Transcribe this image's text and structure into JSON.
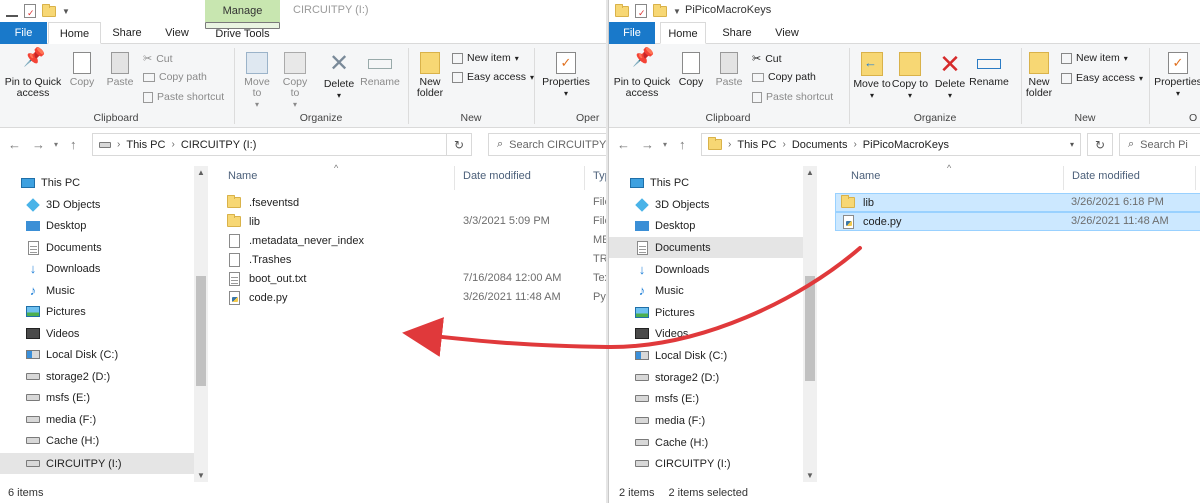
{
  "colors": {
    "file_tab": "#1979ca",
    "manage_tab": "#c8e6b0",
    "selection": "#cce8ff",
    "arrow": "#e0393b"
  },
  "left": {
    "quick_access": [
      "save-icon",
      "properties-icon",
      "new-folder-icon",
      "dropdown-arrow"
    ],
    "manage_label": "Manage",
    "title": "CIRCUITPY (I:)",
    "tabs": {
      "file": "File",
      "home": "Home",
      "share": "Share",
      "view": "View",
      "drive_tools": "Drive Tools"
    },
    "ribbon": {
      "pin": "Pin to Quick access",
      "copy": "Copy",
      "paste": "Paste",
      "cut": "Cut",
      "copy_path": "Copy path",
      "paste_shortcut": "Paste shortcut",
      "move_to": "Move to",
      "copy_to": "Copy to",
      "delete": "Delete",
      "rename": "Rename",
      "new_folder": "New folder",
      "new_item": "New item",
      "easy_access": "Easy access",
      "properties": "Properties",
      "groups": {
        "clipboard": "Clipboard",
        "organize": "Organize",
        "new": "New",
        "open": "Oper"
      }
    },
    "address": {
      "this_pc": "This PC",
      "location": "CIRCUITPY (I:)"
    },
    "search_placeholder": "Search CIRCUITPY",
    "nav": {
      "this_pc": "This PC",
      "objects": "3D Objects",
      "desktop": "Desktop",
      "documents": "Documents",
      "downloads": "Downloads",
      "music": "Music",
      "pictures": "Pictures",
      "videos": "Videos",
      "local_c": "Local Disk (C:)",
      "storage_d": "storage2 (D:)",
      "msfs_e": "msfs (E:)",
      "media_f": "media (F:)",
      "cache_h": "Cache (H:)",
      "circuitpy_i": "CIRCUITPY (I:)"
    },
    "columns": {
      "name": "Name",
      "date": "Date modified",
      "type": "Typ"
    },
    "files": [
      {
        "name": ".fseventsd",
        "date": "",
        "type": "File"
      },
      {
        "name": "lib",
        "date": "3/3/2021 5:09 PM",
        "type": "File"
      },
      {
        "name": ".metadata_never_index",
        "date": "",
        "type": "ME"
      },
      {
        "name": ".Trashes",
        "date": "",
        "type": "TR"
      },
      {
        "name": "boot_out.txt",
        "date": "7/16/2084 12:00 AM",
        "type": "Tex"
      },
      {
        "name": "code.py",
        "date": "3/26/2021 11:48 AM",
        "type": "Py"
      }
    ],
    "status": "6 items"
  },
  "right": {
    "title": "PiPicoMacroKeys",
    "tabs": {
      "file": "File",
      "home": "Home",
      "share": "Share",
      "view": "View"
    },
    "ribbon": {
      "pin": "Pin to Quick access",
      "copy": "Copy",
      "paste": "Paste",
      "cut": "Cut",
      "copy_path": "Copy path",
      "paste_shortcut": "Paste shortcut",
      "move_to": "Move to",
      "copy_to": "Copy to",
      "delete": "Delete",
      "rename": "Rename",
      "new_folder": "New folder",
      "new_item": "New item",
      "easy_access": "Easy access",
      "properties": "Properties",
      "groups": {
        "clipboard": "Clipboard",
        "organize": "Organize",
        "new": "New",
        "open": "O"
      }
    },
    "address": {
      "this_pc": "This PC",
      "documents": "Documents",
      "location": "PiPicoMacroKeys"
    },
    "search_placeholder": "Search Pi",
    "nav": {
      "this_pc": "This PC",
      "objects": "3D Objects",
      "desktop": "Desktop",
      "documents": "Documents",
      "downloads": "Downloads",
      "music": "Music",
      "pictures": "Pictures",
      "videos": "Videos",
      "local_c": "Local Disk (C:)",
      "storage_d": "storage2 (D:)",
      "msfs_e": "msfs (E:)",
      "media_f": "media (F:)",
      "cache_h": "Cache (H:)",
      "circuitpy_i": "CIRCUITPY (I:)"
    },
    "columns": {
      "name": "Name",
      "date": "Date modified"
    },
    "files": [
      {
        "name": "lib",
        "date": "3/26/2021 6:18 PM"
      },
      {
        "name": "code.py",
        "date": "3/26/2021 11:48 AM"
      }
    ],
    "status_count": "2 items",
    "status_selected": "2 items selected"
  }
}
